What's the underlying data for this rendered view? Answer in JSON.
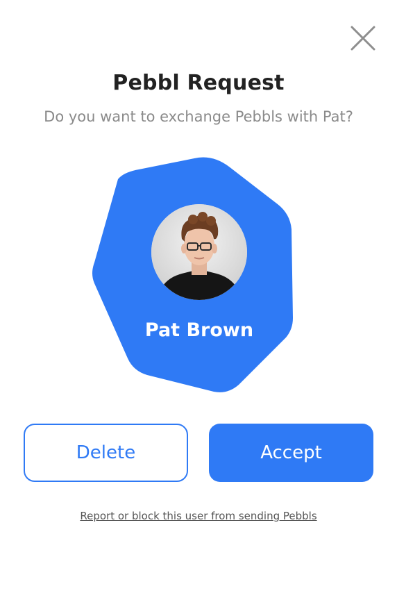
{
  "header": {
    "close_icon": "close-icon",
    "title": "Pebbl Request",
    "subtitle": "Do you want to exchange Pebbls with Pat?"
  },
  "profile": {
    "name": "Pat Brown",
    "avatar": "avatar-photo",
    "badge_color": "#2f7af5"
  },
  "actions": {
    "delete_label": "Delete",
    "accept_label": "Accept",
    "report_label": "Report or block this user from sending Pebbls"
  },
  "colors": {
    "accent": "#2f7af5",
    "title": "#222222",
    "subtitle": "#8a8a8a",
    "link": "#555555"
  }
}
